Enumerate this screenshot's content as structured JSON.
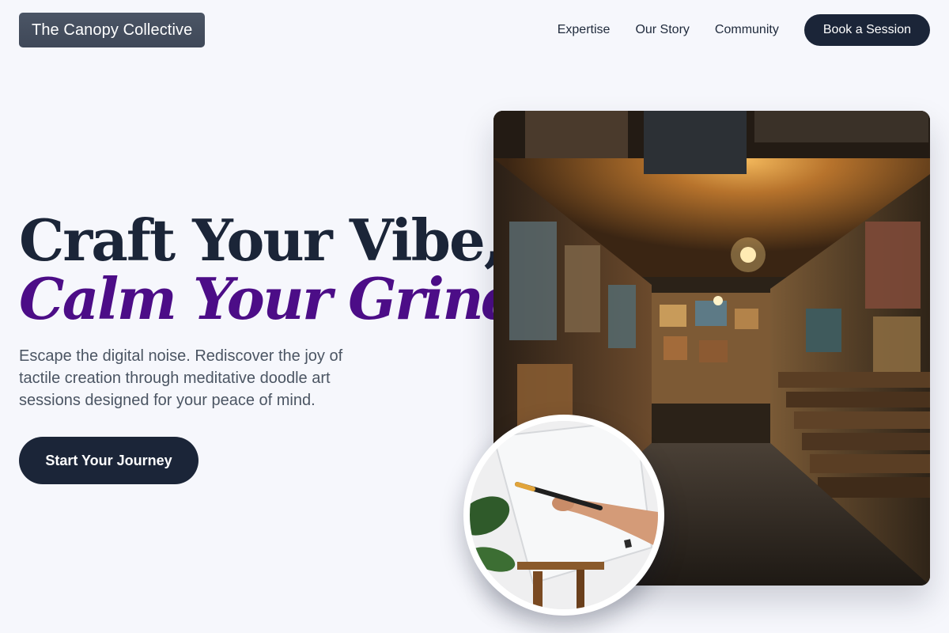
{
  "brand": {
    "name": "The Canopy Collective"
  },
  "nav": {
    "links": [
      "Expertise",
      "Our Story",
      "Community"
    ],
    "cta": "Book a Session"
  },
  "hero": {
    "title_line1": "Craft Your Vibe,",
    "title_line2": "Calm Your Grind.",
    "description": "Escape the digital noise. Rediscover the joy of tactile creation through meditative doodle art sessions designed for your peace of mind.",
    "cta": "Start Your Journey"
  },
  "colors": {
    "background": "#f6f7fc",
    "dark_navy": "#1b2538",
    "accent_purple": "#4c0d87",
    "body_text": "#4b5563"
  },
  "images": {
    "main": "art-gallery-corridor-photo",
    "inset": "painting-on-canvas-photo"
  }
}
